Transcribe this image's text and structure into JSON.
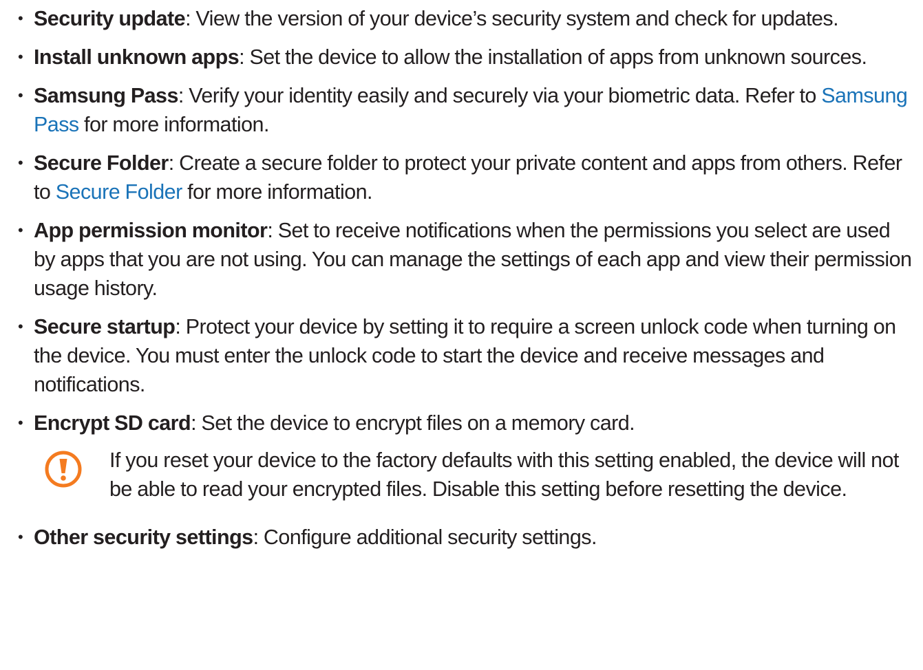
{
  "items": [
    {
      "term": "Security update",
      "text": ": View the version of your device’s security system and check for updates."
    },
    {
      "term": "Install unknown apps",
      "text": ": Set the device to allow the installation of apps from unknown sources."
    },
    {
      "term": "Samsung Pass",
      "text_before": ": Verify your identity easily and securely via your biometric data. Refer to ",
      "link": "Samsung Pass",
      "text_after": " for more information."
    },
    {
      "term": "Secure Folder",
      "text_before": ": Create a secure folder to protect your private content and apps from others. Refer to ",
      "link": "Secure Folder",
      "text_after": " for more information."
    },
    {
      "term": "App permission monitor",
      "text": ": Set to receive notifications when the permissions you select are used by apps that you are not using. You can manage the settings of each app and view their permission usage history."
    },
    {
      "term": "Secure startup",
      "text": ": Protect your device by setting it to require a screen unlock code when turning on the device. You must enter the unlock code to start the device and receive messages and notifications."
    },
    {
      "term": "Encrypt SD card",
      "text": ": Set the device to encrypt files on a memory card."
    },
    {
      "term": "Other security settings",
      "text": ": Configure additional security settings."
    }
  ],
  "caution": {
    "icon": "caution-icon",
    "text": "If you reset your device to the factory defaults with this setting enabled, the device will not be able to read your encrypted files. Disable this setting before resetting the device."
  },
  "colors": {
    "text": "#231f20",
    "link": "#1a73b8",
    "caution_icon": "#f47b20"
  }
}
